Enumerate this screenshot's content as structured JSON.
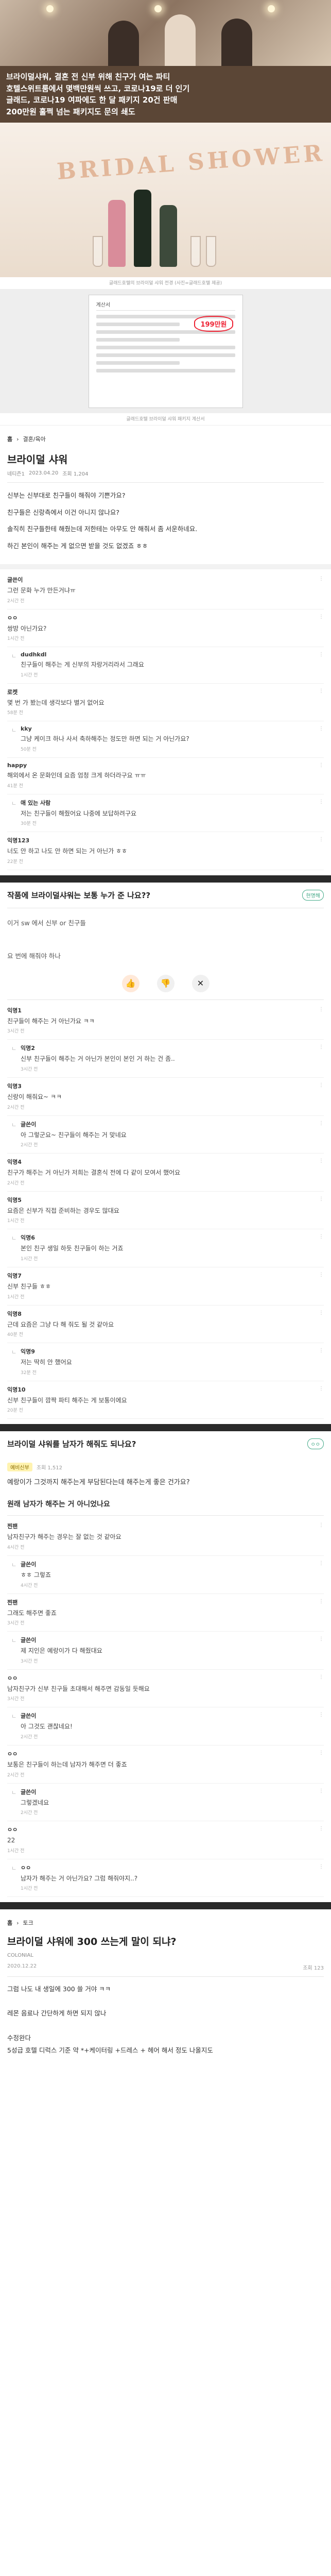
{
  "article": {
    "caption_lines": [
      "브라이덜샤워, 결혼 전 신부 위해 친구가 여는 파티",
      "호텔스위트룸에서 몇백만원씩 쓰고, 코로나19로 더 인기",
      "글래드, 코로나19 여파에도 한 달 패키지 20건 판매",
      "200만원 훌쩍 넘는 패키지도 문의 쇄도"
    ],
    "photo_caption_1": "글래드호텔의 브라이덜 샤워 전경 (사진=글래드호텔 제공)",
    "photo_caption_2": "글래드호텔 브라이덜 샤워 패키지 계산서"
  },
  "receipt": {
    "title": "계산서",
    "price": "199만원"
  },
  "post1": {
    "nav": [
      "홈",
      "결혼/육아"
    ],
    "title": "브라이덜 샤워",
    "author": "네티즌1",
    "time": "2023.04.20",
    "views": "조회 1,204",
    "body": [
      "신부는 신부대로 친구들이 해줘야 기쁜가요?",
      "친구들은 신랑측에서 이건 아니지 않나요?",
      "솔직히 친구들한테 해줬는데 저한테는 아무도 안 해줘서 좀 서운하네요.",
      "하긴 본인이 해주는 게 없으면 받을 것도 없겠죠 ㅎㅎ"
    ]
  },
  "post1_comments": [
    {
      "nick": "글쓴이",
      "txt": "그런 문화 누가 만든거냐ㅠ",
      "time": "2시간 전",
      "reply": false
    },
    {
      "nick": "ㅇㅇ",
      "txt": "쌍방 아닌가요?",
      "time": "1시간 전",
      "reply": false
    },
    {
      "nick": "dudhkdl",
      "txt": "친구들이 해주는 게 신부의 자랑거리라서 그래요",
      "time": "1시간 전",
      "reply": true
    },
    {
      "nick": "로켓",
      "txt": "몇 번 가 봤는데 생각보다 별거 없어요",
      "time": "58분 전",
      "reply": false
    },
    {
      "nick": "kky",
      "txt": "그냥 케이크 하나 사서 축하해주는 정도만 하면 되는 거 아닌가요?",
      "time": "50분 전",
      "reply": true
    },
    {
      "nick": "happy",
      "txt": "해외에서 온 문화인데 요즘 엄청 크게 하더라구요 ㅠㅠ",
      "time": "41분 전",
      "reply": false
    },
    {
      "nick": "애 있는 사람",
      "txt": "저는 친구들이 해줬어요 나중에 보답하려구요",
      "time": "30분 전",
      "reply": true
    },
    {
      "nick": "익명123",
      "txt": "너도 안 하고 나도 안 하면 되는 거 아닌가 ㅎㅎ",
      "time": "22분 전",
      "reply": false
    }
  ],
  "post2": {
    "title": "작품에 브라이덜샤워는 보통 누가 준 나요??",
    "flag": "현명해",
    "body": "이거 sw 에서 신부 or 친구들",
    "question": "요 번에 해줘야 하나",
    "reactions": [
      "good-icon",
      "bad-icon",
      "cross-icon"
    ]
  },
  "post2_comments": [
    {
      "nick": "익명1",
      "txt": "친구들이 해주는 거 아닌가요 ㅋㅋ",
      "time": "3시간 전",
      "reply": false
    },
    {
      "nick": "익명2",
      "txt": "신부 친구들이 해주는 거 아닌가 본인이 본인 거 하는 건 좀..",
      "time": "3시간 전",
      "reply": true
    },
    {
      "nick": "익명3",
      "txt": "신랑이 해줘요~ ㅋㅋ",
      "time": "2시간 전",
      "reply": false
    },
    {
      "nick": "글쓴이",
      "txt": "아 그렇군요~ 친구들이 해주는 거 맞네요",
      "time": "2시간 전",
      "reply": true
    },
    {
      "nick": "익명4",
      "txt": "친구가 해주는 거 아닌가 저희는 결혼식 전에 다 같이 모여서 했어요",
      "time": "2시간 전",
      "reply": false
    },
    {
      "nick": "익명5",
      "txt": "요즘은 신부가 직접 준비하는 경우도 많대요",
      "time": "1시간 전",
      "reply": false
    },
    {
      "nick": "익명6",
      "txt": "본인 친구 생일 하듯 친구들이 하는 거죠",
      "time": "1시간 전",
      "reply": true
    },
    {
      "nick": "익명7",
      "txt": "신부 친구들 ㅎㅎ",
      "time": "1시간 전",
      "reply": false
    },
    {
      "nick": "익명8",
      "txt": "근데 요즘은 그냥 다 해 줘도 될 것 같아요",
      "time": "40분 전",
      "reply": false
    },
    {
      "nick": "익명9",
      "txt": "저는 딱히 안 했어요",
      "time": "32분 전",
      "reply": true
    },
    {
      "nick": "익명10",
      "txt": "신부 친구들이 깜짝 파티 해주는 게 보통이에요",
      "time": "20분 전",
      "reply": false
    }
  ],
  "post3": {
    "title": "브라이덜 샤워를 남자가 해줘도 되나요?",
    "flag": "ㅇㅇ",
    "tag": "예비신부",
    "time": "조회 1,512",
    "body": "예랑이가 그것까지 해주는게 부담된다는데 해주는게 좋은 건가요?",
    "question": "원래 남자가 해주는 거 아니었나요"
  },
  "post3_comments": [
    {
      "nick": "찐팬",
      "txt": "남자친구가 해주는 경우는 잘 없는 것 같아요",
      "time": "4시간 전",
      "reply": false
    },
    {
      "nick": "글쓴이",
      "txt": "ㅎㅎ 그렇죠",
      "time": "4시간 전",
      "reply": true
    },
    {
      "nick": "찐팬",
      "txt": "그래도 해주면 좋죠",
      "time": "3시간 전",
      "reply": false
    },
    {
      "nick": "글쓴이",
      "txt": "제 지인은 예랑이가 다 해줬대요",
      "time": "3시간 전",
      "reply": true
    },
    {
      "nick": "ㅇㅇ",
      "txt": "남자친구가 신부 친구들 초대해서 해주면 감동일 듯해요",
      "time": "3시간 전",
      "reply": false
    },
    {
      "nick": "글쓴이",
      "txt": "아 그것도 괜찮네요!",
      "time": "2시간 전",
      "reply": true
    },
    {
      "nick": "ㅇㅇ",
      "txt": "보통은 친구들이 하는데 남자가 해주면 더 좋죠",
      "time": "2시간 전",
      "reply": false
    },
    {
      "nick": "글쓴이",
      "txt": "그렇겠네요",
      "time": "2시간 전",
      "reply": true
    },
    {
      "nick": "ㅇㅇ",
      "txt": "22",
      "time": "1시간 전",
      "reply": false
    },
    {
      "nick": "ㅇㅇ",
      "txt": "남자가 해주는 거 아닌가요? 그럼 해줘야지..?",
      "time": "1시간 전",
      "reply": true
    }
  ],
  "post4": {
    "nav": [
      "홈",
      "토크"
    ],
    "title": "브라이덜 샤워에 300 쓰는게 말이 되냐?",
    "author": "COLONIAL",
    "time": "2020.12.22",
    "views": "조회 123",
    "body": [
      "그럼 나도 내 생일에 300 쓸 거야 ㅋㅋ",
      "",
      "레몬 음료나 간단하게 하면 되지 않나",
      "",
      "수정완다",
      "5성급 호텔 디럭스 기준 약 *+케이터링 +드레스 + 헤어 해서 정도 나올지도"
    ]
  }
}
